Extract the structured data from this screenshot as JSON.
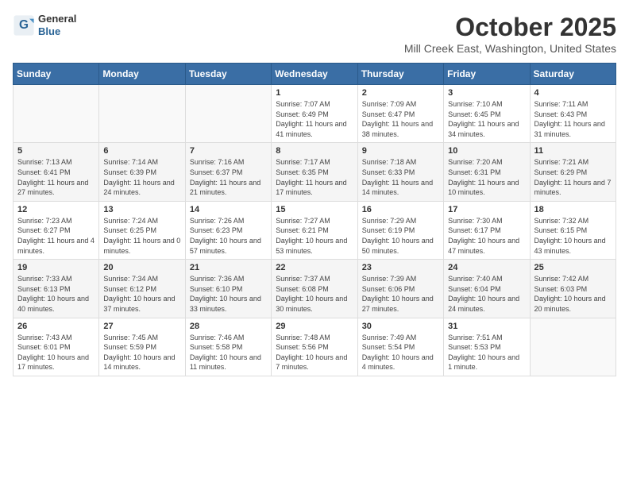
{
  "header": {
    "logo_general": "General",
    "logo_blue": "Blue",
    "month_title": "October 2025",
    "location": "Mill Creek East, Washington, United States"
  },
  "weekdays": [
    "Sunday",
    "Monday",
    "Tuesday",
    "Wednesday",
    "Thursday",
    "Friday",
    "Saturday"
  ],
  "weeks": [
    [
      {
        "day": "",
        "info": ""
      },
      {
        "day": "",
        "info": ""
      },
      {
        "day": "",
        "info": ""
      },
      {
        "day": "1",
        "info": "Sunrise: 7:07 AM\nSunset: 6:49 PM\nDaylight: 11 hours and 41 minutes."
      },
      {
        "day": "2",
        "info": "Sunrise: 7:09 AM\nSunset: 6:47 PM\nDaylight: 11 hours and 38 minutes."
      },
      {
        "day": "3",
        "info": "Sunrise: 7:10 AM\nSunset: 6:45 PM\nDaylight: 11 hours and 34 minutes."
      },
      {
        "day": "4",
        "info": "Sunrise: 7:11 AM\nSunset: 6:43 PM\nDaylight: 11 hours and 31 minutes."
      }
    ],
    [
      {
        "day": "5",
        "info": "Sunrise: 7:13 AM\nSunset: 6:41 PM\nDaylight: 11 hours and 27 minutes."
      },
      {
        "day": "6",
        "info": "Sunrise: 7:14 AM\nSunset: 6:39 PM\nDaylight: 11 hours and 24 minutes."
      },
      {
        "day": "7",
        "info": "Sunrise: 7:16 AM\nSunset: 6:37 PM\nDaylight: 11 hours and 21 minutes."
      },
      {
        "day": "8",
        "info": "Sunrise: 7:17 AM\nSunset: 6:35 PM\nDaylight: 11 hours and 17 minutes."
      },
      {
        "day": "9",
        "info": "Sunrise: 7:18 AM\nSunset: 6:33 PM\nDaylight: 11 hours and 14 minutes."
      },
      {
        "day": "10",
        "info": "Sunrise: 7:20 AM\nSunset: 6:31 PM\nDaylight: 11 hours and 10 minutes."
      },
      {
        "day": "11",
        "info": "Sunrise: 7:21 AM\nSunset: 6:29 PM\nDaylight: 11 hours and 7 minutes."
      }
    ],
    [
      {
        "day": "12",
        "info": "Sunrise: 7:23 AM\nSunset: 6:27 PM\nDaylight: 11 hours and 4 minutes."
      },
      {
        "day": "13",
        "info": "Sunrise: 7:24 AM\nSunset: 6:25 PM\nDaylight: 11 hours and 0 minutes."
      },
      {
        "day": "14",
        "info": "Sunrise: 7:26 AM\nSunset: 6:23 PM\nDaylight: 10 hours and 57 minutes."
      },
      {
        "day": "15",
        "info": "Sunrise: 7:27 AM\nSunset: 6:21 PM\nDaylight: 10 hours and 53 minutes."
      },
      {
        "day": "16",
        "info": "Sunrise: 7:29 AM\nSunset: 6:19 PM\nDaylight: 10 hours and 50 minutes."
      },
      {
        "day": "17",
        "info": "Sunrise: 7:30 AM\nSunset: 6:17 PM\nDaylight: 10 hours and 47 minutes."
      },
      {
        "day": "18",
        "info": "Sunrise: 7:32 AM\nSunset: 6:15 PM\nDaylight: 10 hours and 43 minutes."
      }
    ],
    [
      {
        "day": "19",
        "info": "Sunrise: 7:33 AM\nSunset: 6:13 PM\nDaylight: 10 hours and 40 minutes."
      },
      {
        "day": "20",
        "info": "Sunrise: 7:34 AM\nSunset: 6:12 PM\nDaylight: 10 hours and 37 minutes."
      },
      {
        "day": "21",
        "info": "Sunrise: 7:36 AM\nSunset: 6:10 PM\nDaylight: 10 hours and 33 minutes."
      },
      {
        "day": "22",
        "info": "Sunrise: 7:37 AM\nSunset: 6:08 PM\nDaylight: 10 hours and 30 minutes."
      },
      {
        "day": "23",
        "info": "Sunrise: 7:39 AM\nSunset: 6:06 PM\nDaylight: 10 hours and 27 minutes."
      },
      {
        "day": "24",
        "info": "Sunrise: 7:40 AM\nSunset: 6:04 PM\nDaylight: 10 hours and 24 minutes."
      },
      {
        "day": "25",
        "info": "Sunrise: 7:42 AM\nSunset: 6:03 PM\nDaylight: 10 hours and 20 minutes."
      }
    ],
    [
      {
        "day": "26",
        "info": "Sunrise: 7:43 AM\nSunset: 6:01 PM\nDaylight: 10 hours and 17 minutes."
      },
      {
        "day": "27",
        "info": "Sunrise: 7:45 AM\nSunset: 5:59 PM\nDaylight: 10 hours and 14 minutes."
      },
      {
        "day": "28",
        "info": "Sunrise: 7:46 AM\nSunset: 5:58 PM\nDaylight: 10 hours and 11 minutes."
      },
      {
        "day": "29",
        "info": "Sunrise: 7:48 AM\nSunset: 5:56 PM\nDaylight: 10 hours and 7 minutes."
      },
      {
        "day": "30",
        "info": "Sunrise: 7:49 AM\nSunset: 5:54 PM\nDaylight: 10 hours and 4 minutes."
      },
      {
        "day": "31",
        "info": "Sunrise: 7:51 AM\nSunset: 5:53 PM\nDaylight: 10 hours and 1 minute."
      },
      {
        "day": "",
        "info": ""
      }
    ]
  ]
}
